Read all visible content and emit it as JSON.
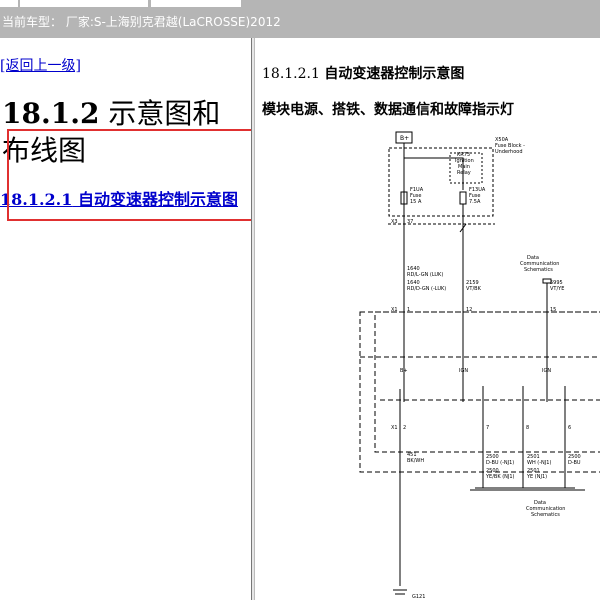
{
  "header": {
    "vehicle_label": "当前车型：  厂家:S-上海别克君越(LaCROSSE)2012"
  },
  "left": {
    "back_link": "[返回上一级]",
    "section_number": "18.1.2",
    "section_title": " 示意图和布线图",
    "subsection_number": "18.1.2.1",
    "subsection_title": " 自动变速器控制示意图"
  },
  "right": {
    "title_number": "18.1.2.1 ",
    "title_text": "自动变速器控制示意图",
    "subtitle": "模块电源、搭铁、数据通信和故障指示灯"
  },
  "diagram": {
    "bplus_box": "B+",
    "x50a": "X50A",
    "fuse_block": "Fuse Block -",
    "underhood": "Underhood",
    "kr73": "KR73",
    "ignition": "Ignition",
    "main": "Main",
    "relay": "Relay",
    "f1ua": "F1UA",
    "fuse": "Fuse",
    "f1ua_amp": "15 A",
    "f13ua": "F13UA",
    "f13ua_fuse": "Fuse",
    "f13ua_amp": "7.5A",
    "x3_top": "X3",
    "pin_37": "37",
    "data": "Data",
    "communication": "Communication",
    "schematics": "Schematics",
    "w1640_a": "1640",
    "w1640_a_color": "RD/L-GN (LUK)",
    "w1640_b": "1640",
    "w1640_b_color": "RD/D-GN (-LUK)",
    "w2159": "2159",
    "w2159_color": "VT/BK",
    "w5995": "5995",
    "w5995_color": "VT/YE",
    "x1_top": "X1",
    "pin_1": "1",
    "pin_12": "12",
    "pin_15": "15",
    "lbl_bplus": "B+",
    "lbl_ign1": "IGN",
    "lbl_ign2": "IGN",
    "x1_bot": "X1",
    "pin_2": "2",
    "pin_7": "7",
    "pin_8": "8",
    "pin_6": "6",
    "w451": "451",
    "w451_color": "BK/WH",
    "w2500_a": "2500",
    "w2500_a_color": "D-BU (-NJ1)",
    "w2500_b": "2500",
    "w2500_b_color": "YE/BK (NJ1)",
    "w2501_a": "2501",
    "w2501_a_color": "WH (-NJ1)",
    "w2501_b": "2501",
    "w2501_b_color": "YE (NJ1)",
    "w2500_c": "2500",
    "w2500_c_color": "D-BU",
    "data2": "Data",
    "communication2": "Communication",
    "schematics2": "Schematics",
    "ground": "G121"
  }
}
